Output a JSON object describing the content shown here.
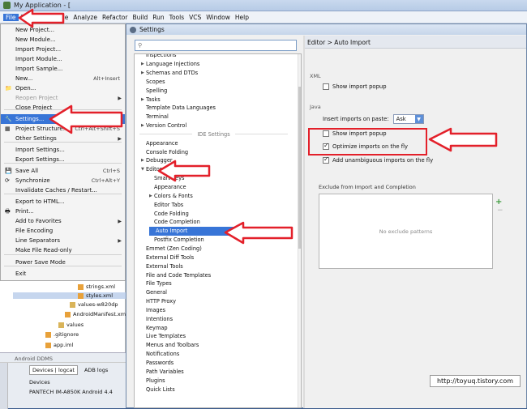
{
  "window": {
    "title": "My Application - ["
  },
  "menubar": [
    "File",
    "Navigate",
    "Code",
    "Analyze",
    "Refactor",
    "Build",
    "Run",
    "Tools",
    "VCS",
    "Window",
    "Help"
  ],
  "file_menu": [
    {
      "label": "New Project...",
      "shortcut": "",
      "icon": ""
    },
    {
      "label": "New Module...",
      "shortcut": "",
      "icon": ""
    },
    {
      "label": "Import Project...",
      "shortcut": "",
      "icon": ""
    },
    {
      "label": "Import Module...",
      "shortcut": "",
      "icon": ""
    },
    {
      "label": "Import Sample...",
      "shortcut": "",
      "icon": ""
    },
    {
      "label": "New...",
      "shortcut": "Alt+Insert",
      "icon": ""
    },
    {
      "label": "Open...",
      "shortcut": "",
      "icon": "folder-icon"
    },
    {
      "label": "Reopen Project",
      "shortcut": "",
      "icon": "",
      "dim": true,
      "submenu": true
    },
    {
      "label": "Close Project",
      "shortcut": "",
      "icon": ""
    },
    {
      "label": "Settings...",
      "shortcut": "Ctrl+Alt+S",
      "icon": "wrench-icon",
      "highlight": true
    },
    {
      "label": "Project Structure...",
      "shortcut": "Ctrl+Alt+Shift+S",
      "icon": "structure-icon"
    },
    {
      "label": "Other Settings",
      "shortcut": "",
      "icon": "",
      "submenu": true
    },
    {
      "label": "Import Settings...",
      "shortcut": "",
      "icon": ""
    },
    {
      "label": "Export Settings...",
      "shortcut": "",
      "icon": ""
    },
    {
      "label": "Save All",
      "shortcut": "Ctrl+S",
      "icon": "save-icon"
    },
    {
      "label": "Synchronize",
      "shortcut": "Ctrl+Alt+Y",
      "icon": "sync-icon"
    },
    {
      "label": "Invalidate Caches / Restart...",
      "shortcut": "",
      "icon": ""
    },
    {
      "label": "Export to HTML...",
      "shortcut": "",
      "icon": ""
    },
    {
      "label": "Print...",
      "shortcut": "",
      "icon": "print-icon"
    },
    {
      "label": "Add to Favorites",
      "shortcut": "",
      "icon": "",
      "submenu": true
    },
    {
      "label": "File Encoding",
      "shortcut": "",
      "icon": ""
    },
    {
      "label": "Line Separators",
      "shortcut": "",
      "icon": "",
      "submenu": true
    },
    {
      "label": "Make File Read-only",
      "shortcut": "",
      "icon": ""
    },
    {
      "label": "Power Save Mode",
      "shortcut": "",
      "icon": ""
    },
    {
      "label": "Exit",
      "shortcut": "",
      "icon": ""
    }
  ],
  "project_tree": [
    {
      "label": "strings.xml"
    },
    {
      "label": "styles.xml"
    },
    {
      "label": "values-w820dp"
    },
    {
      "label": "AndroidManifest.xml"
    },
    {
      "label": "values"
    },
    {
      "label": ".gitignore"
    },
    {
      "label": "app.iml"
    }
  ],
  "ddms": {
    "title": "Android DDMS",
    "tab_devices": "Devices | logcat",
    "tab_adb": "ADB logs",
    "devices_label": "Devices",
    "device": "PANTECH IM-A850K Android 4.4"
  },
  "settings": {
    "title": "Settings",
    "tree": [
      {
        "label": "Inspections",
        "indent": 0
      },
      {
        "label": "Language Injections",
        "indent": 0,
        "arrow": true
      },
      {
        "label": "Schemas and DTDs",
        "indent": 0,
        "arrow": true
      },
      {
        "label": "Scopes",
        "indent": 0
      },
      {
        "label": "Spelling",
        "indent": 0
      },
      {
        "label": "Tasks",
        "indent": 0,
        "arrow": true
      },
      {
        "label": "Template Data Languages",
        "indent": 0
      },
      {
        "label": "Terminal",
        "indent": 0
      },
      {
        "label": "Version Control",
        "indent": 0,
        "arrow": true
      },
      {
        "label": "IDE Settings",
        "section": true
      },
      {
        "label": "Appearance",
        "indent": 0
      },
      {
        "label": "Console Folding",
        "indent": 0
      },
      {
        "label": "Debugger",
        "indent": 0,
        "arrow": true
      },
      {
        "label": "Editor",
        "indent": 0,
        "expanded": true
      },
      {
        "label": "Smart Keys",
        "indent": 1
      },
      {
        "label": "Appearance",
        "indent": 1
      },
      {
        "label": "Colors & Fonts",
        "indent": 1,
        "arrow": true
      },
      {
        "label": "Editor Tabs",
        "indent": 1
      },
      {
        "label": "Code Folding",
        "indent": 1
      },
      {
        "label": "Code Completion",
        "indent": 1
      },
      {
        "label": "Auto Import",
        "indent": 1,
        "selected": true
      },
      {
        "label": "Postfix Completion",
        "indent": 1
      },
      {
        "label": "Emmet (Zen Coding)",
        "indent": 0
      },
      {
        "label": "External Diff Tools",
        "indent": 0
      },
      {
        "label": "External Tools",
        "indent": 0
      },
      {
        "label": "File and Code Templates",
        "indent": 0
      },
      {
        "label": "File Types",
        "indent": 0
      },
      {
        "label": "General",
        "indent": 0
      },
      {
        "label": "HTTP Proxy",
        "indent": 0
      },
      {
        "label": "Images",
        "indent": 0
      },
      {
        "label": "Intentions",
        "indent": 0
      },
      {
        "label": "Keymap",
        "indent": 0
      },
      {
        "label": "Live Templates",
        "indent": 0
      },
      {
        "label": "Menus and Toolbars",
        "indent": 0
      },
      {
        "label": "Notifications",
        "indent": 0
      },
      {
        "label": "Passwords",
        "indent": 0
      },
      {
        "label": "Path Variables",
        "indent": 0
      },
      {
        "label": "Plugins",
        "indent": 0
      },
      {
        "label": "Quick Lists",
        "indent": 0
      }
    ],
    "panel": {
      "header": "Editor > Auto Import",
      "xml_label": "XML",
      "xml_show_popup": "Show import popup",
      "java_label": "Java",
      "insert_on_paste_label": "Insert imports on paste:",
      "insert_on_paste_value": "Ask",
      "java_show_popup": "Show import popup",
      "optimize_on_fly": "Optimize imports on the fly",
      "add_unambiguous": "Add unambiguous imports on the fly",
      "exclude_label": "Exclude from Import and Completion",
      "no_exclude": "No exclude patterns"
    }
  },
  "watermark": "http://toyuq.tistory.com",
  "colors": {
    "selection": "#3875d7",
    "annotation": "#e3202a"
  }
}
